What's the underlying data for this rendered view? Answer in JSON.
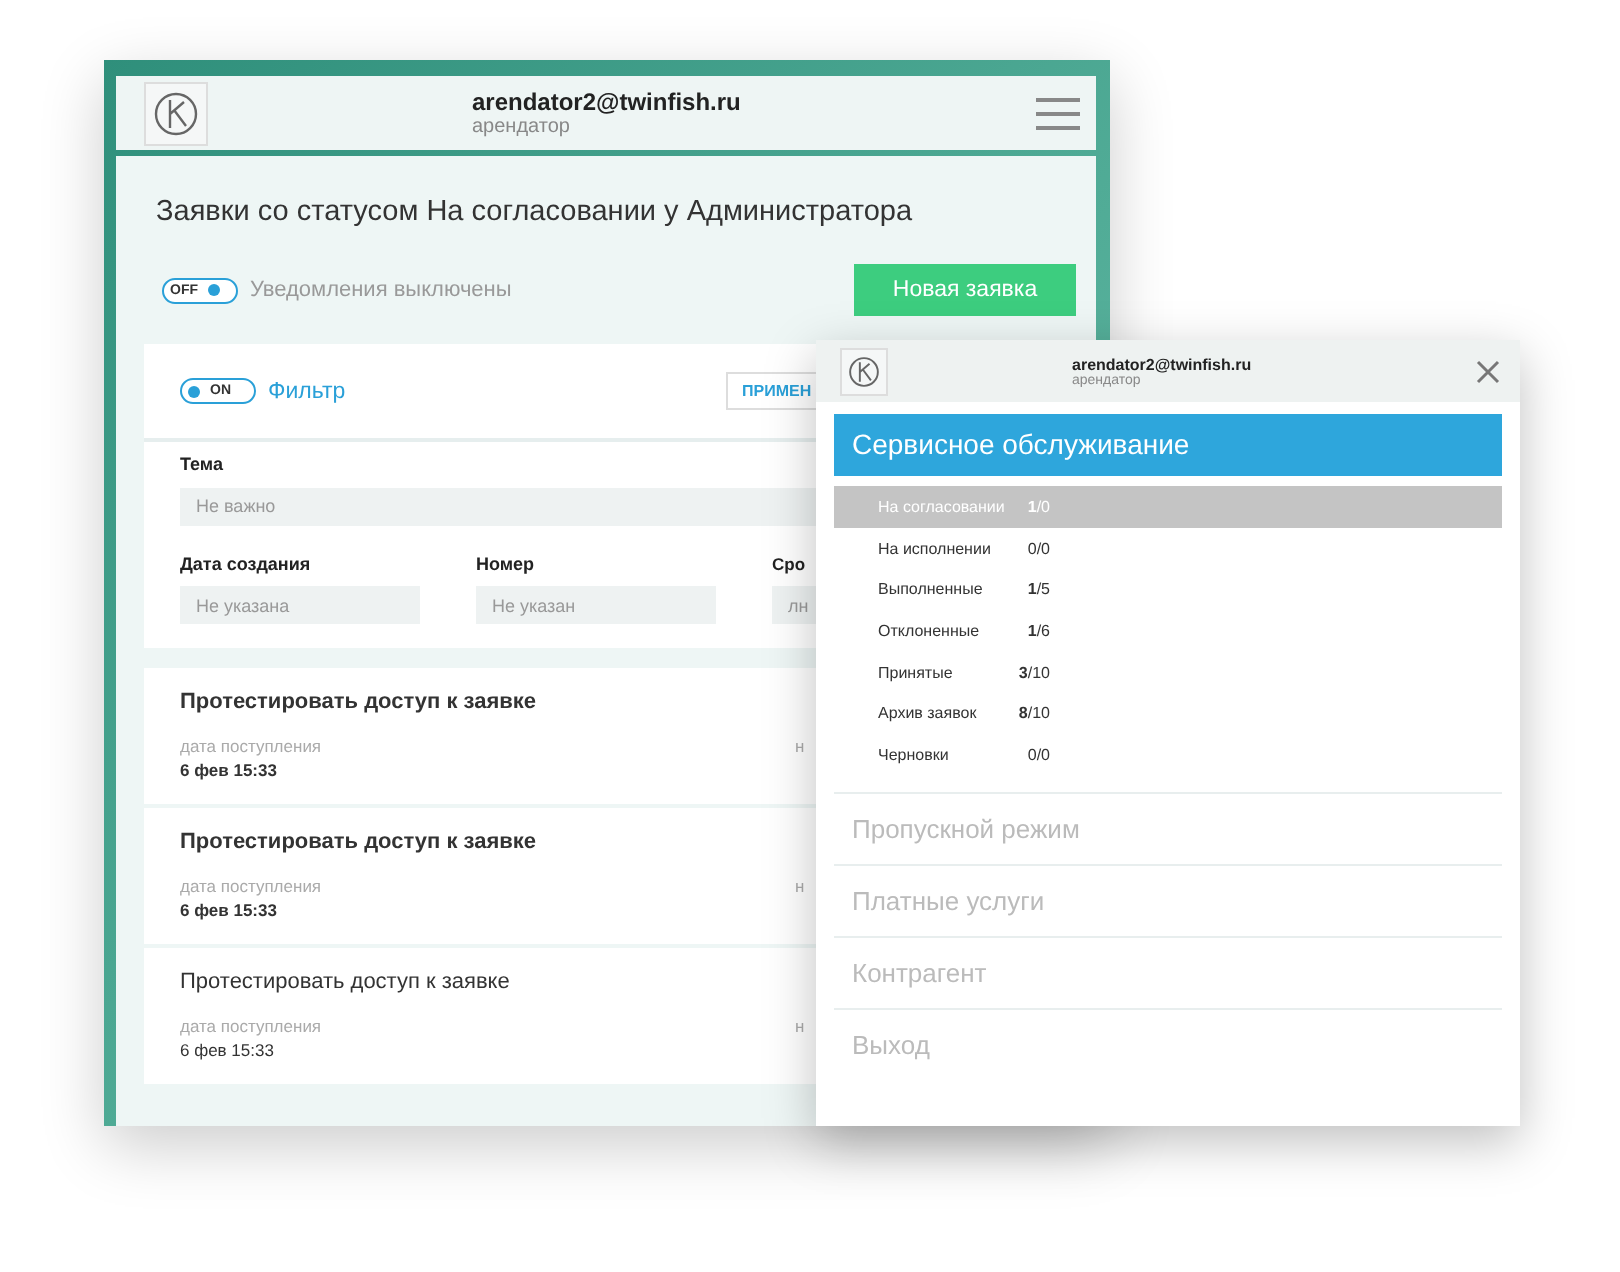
{
  "header": {
    "email": "arendator2@twinfish.ru",
    "role": "арендатор"
  },
  "page_title": "Заявки со статусом На согласовании у Администратора",
  "notifications": {
    "on": false,
    "toggle_text": "OFF",
    "label": "Уведомления выключены"
  },
  "new_button": "Новая заявка",
  "filter": {
    "on": true,
    "toggle_text": "ON",
    "label": "Фильтр",
    "apply_button": "ПРИМЕН",
    "topic": {
      "label": "Тема",
      "placeholder": "Не важно"
    },
    "fields": [
      {
        "label": "Дата создания",
        "placeholder": "Не указана"
      },
      {
        "label": "Номер",
        "placeholder": "Не указан"
      },
      {
        "label": "Сро",
        "placeholder": "лн"
      }
    ]
  },
  "requests": [
    {
      "title": "Протестировать доступ к заявке",
      "date_label": "дата поступления",
      "date": "6 фев 15:33",
      "column_2": "н",
      "unread": true
    },
    {
      "title": "Протестировать доступ к заявке",
      "date_label": "дата поступления",
      "date": "6 фев 15:33",
      "column_2": "н",
      "unread": true
    },
    {
      "title": "Протестировать доступ к заявке",
      "date_label": "дата поступления",
      "date": "6 фев 15:33",
      "column_2": "н",
      "unread": false
    }
  ],
  "drawer": {
    "email": "arendator2@twinfish.ru",
    "role": "арендатор",
    "menu": [
      {
        "label": "Сервисное обслуживание",
        "selected": true,
        "children": [
          {
            "label": "На согласовании",
            "count": "**1**/0",
            "selected": true
          },
          {
            "label": "На исполнении",
            "count": "0/0",
            "selected": false
          },
          {
            "label": "Выполненные",
            "count": "**1**/5",
            "selected": false
          },
          {
            "label": "Отклоненные",
            "count": "**1**/6",
            "selected": false
          },
          {
            "label": "Принятые",
            "count": "**3**/10",
            "selected": false
          },
          {
            "label": "Архив заявок",
            "count": "**8**/10",
            "selected": false
          },
          {
            "label": "Черновки",
            "count": "0/0",
            "selected": false
          }
        ]
      },
      {
        "label": "Пропускной режим",
        "selected": false
      },
      {
        "label": "Платные услуги",
        "selected": false
      },
      {
        "label": "Контрагент",
        "selected": false
      },
      {
        "label": "Выход",
        "selected": false
      }
    ]
  }
}
